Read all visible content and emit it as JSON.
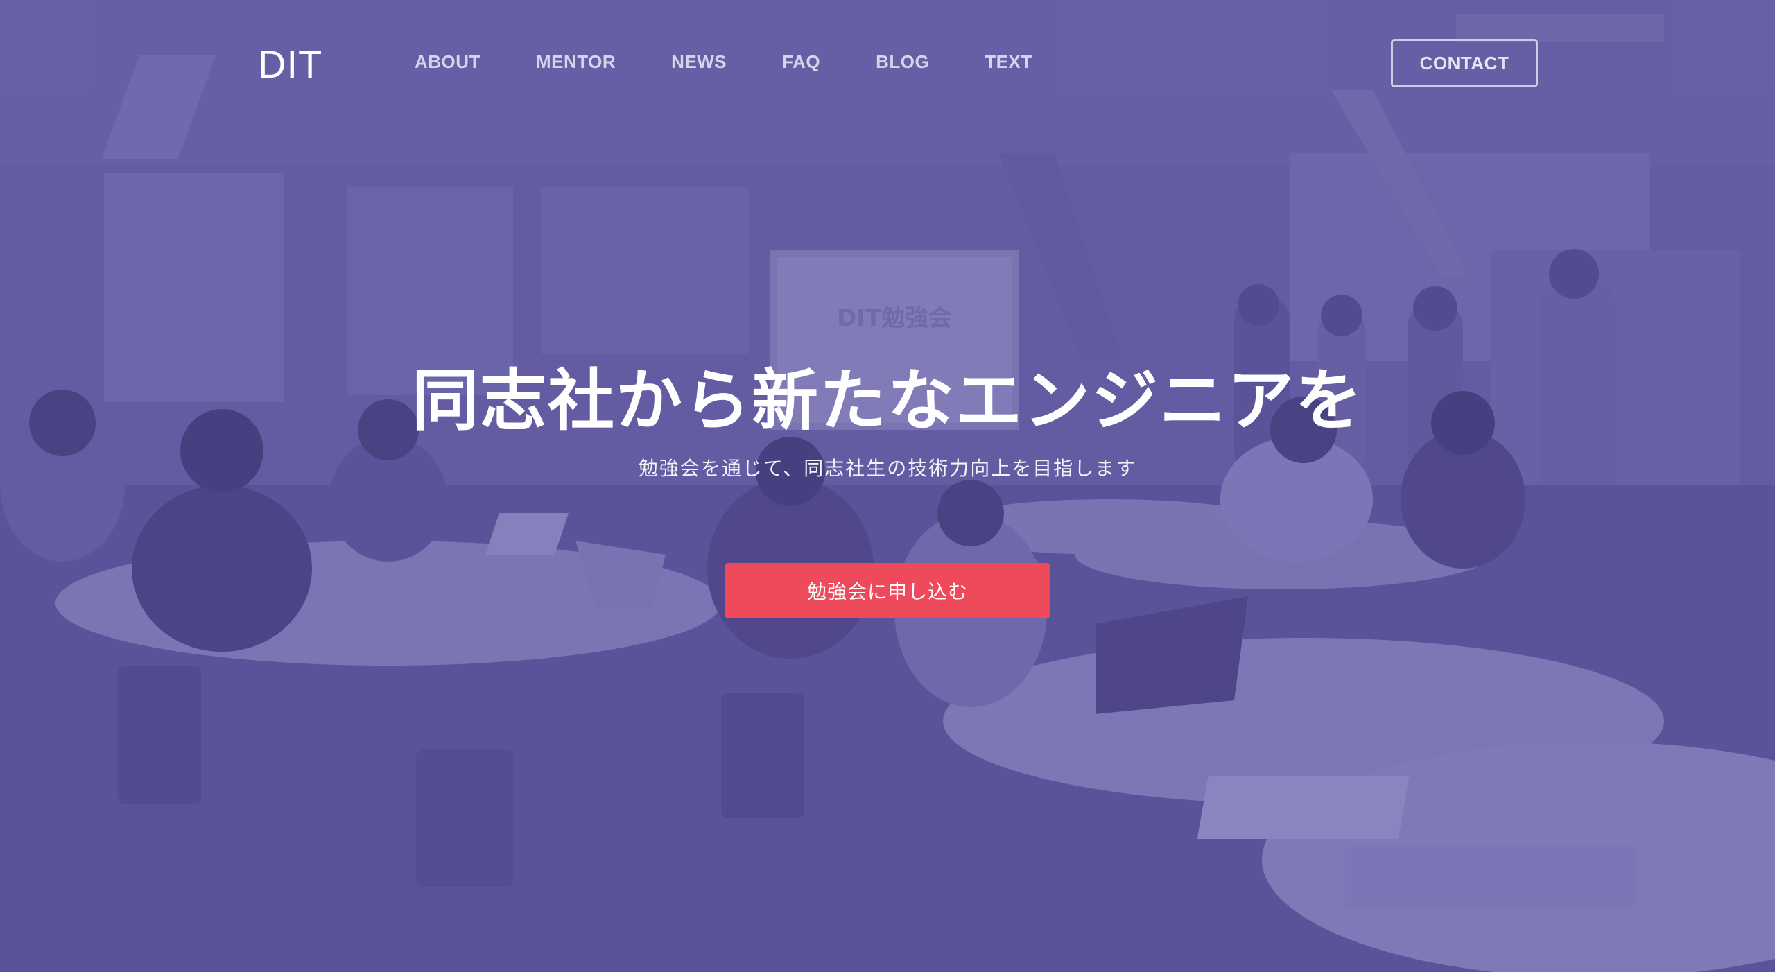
{
  "header": {
    "logo": "DIT",
    "nav": [
      "ABOUT",
      "MENTOR",
      "NEWS",
      "FAQ",
      "BLOG",
      "TEXT"
    ],
    "contact_label": "CONTACT"
  },
  "hero": {
    "title": "同志社から新たなエンジニアを",
    "subtitle": "勉強会を通じて、同志社生の技術力向上を目指します",
    "cta_label": "勉強会に申し込む",
    "screen_text": "DIT勉強会"
  },
  "colors": {
    "overlay": "#5d5698",
    "cta": "#ef4a5b"
  }
}
